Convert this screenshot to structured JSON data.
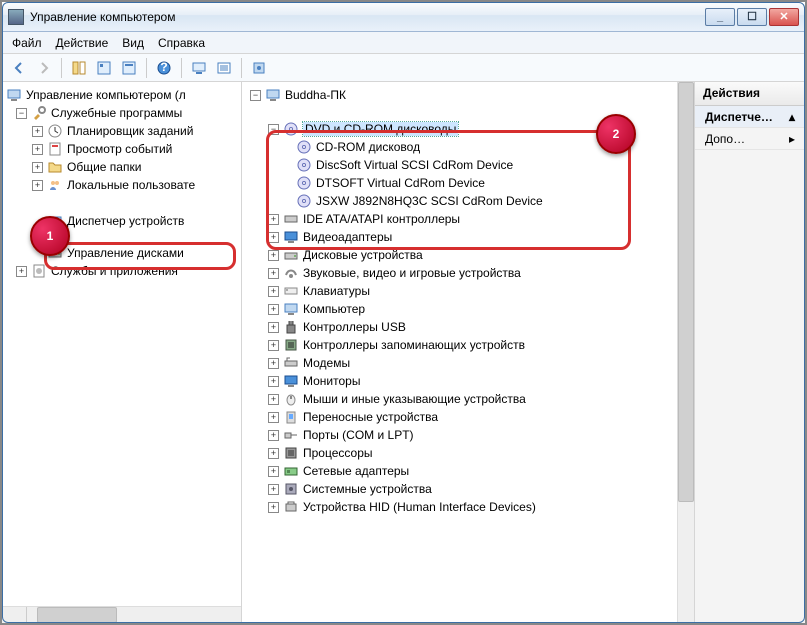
{
  "window": {
    "title": "Управление компьютером",
    "min": "_",
    "max": "☐",
    "close": "✕"
  },
  "menu": {
    "file": "Файл",
    "action": "Действие",
    "view": "Вид",
    "help": "Справка"
  },
  "left_tree": {
    "root": "Управление компьютером (л",
    "utilities": "Служебные программы",
    "scheduler": "Планировщик заданий",
    "eventviewer": "Просмотр событий",
    "sharedfolders": "Общие папки",
    "localusers": "Локальные пользовате",
    "perf_hidden": "",
    "devmgr": "Диспетчер устройств",
    "storage_hidden": "",
    "diskmgmt": "Управление дисками",
    "services": "Службы и приложения"
  },
  "center_tree": {
    "root": "Buddha-ПК",
    "item_hidden": "",
    "dvd_group": "DVD и CD-ROM дисководы",
    "dvd_children": [
      "CD-ROM дисковод",
      "DiscSoft Virtual SCSI CdRom Device",
      "DTSOFT Virtual CdRom Device",
      "JSXW J892N8HQ3C SCSI CdRom Device"
    ],
    "categories": [
      "IDE ATA/ATAPI контроллеры",
      "Видеоадаптеры",
      "Дисковые устройства",
      "Звуковые, видео и игровые устройства",
      "Клавиатуры",
      "Компьютер",
      "Контроллеры USB",
      "Контроллеры запоминающих устройств",
      "Модемы",
      "Мониторы",
      "Мыши и иные указывающие устройства",
      "Переносные устройства",
      "Порты (COM и LPT)",
      "Процессоры",
      "Сетевые адаптеры",
      "Системные устройства",
      "Устройства HID (Human Interface Devices)"
    ]
  },
  "right_pane": {
    "header": "Действия",
    "devmgr_short": "Диспетче…",
    "more": "Допо…"
  },
  "badges": {
    "one": "1",
    "two": "2"
  }
}
